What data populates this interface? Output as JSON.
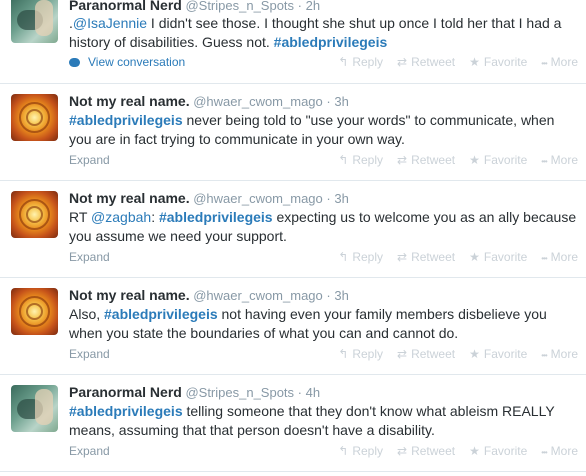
{
  "actions": {
    "reply": "Reply",
    "retweet": "Retweet",
    "favorite": "Favorite",
    "more": "More",
    "expand": "Expand",
    "view_conversation": "View conversation"
  },
  "tweets": [
    {
      "name": "Paranormal Nerd",
      "handle": "@Stripes_n_Spots",
      "time": "2h",
      "parts": [
        {
          "type": "text",
          "v": "."
        },
        {
          "type": "link",
          "v": "@IsaJennie"
        },
        {
          "type": "text",
          "v": " I didn't see those. I thought she shut up once I told her that I had a history of disabilities. Guess not. "
        },
        {
          "type": "hash",
          "v": "#abledprivilegeis"
        }
      ]
    },
    {
      "name": "Not my real name.",
      "handle": "@hwaer_cwom_mago",
      "time": "3h",
      "parts": [
        {
          "type": "hash",
          "v": "#abledprivilegeis"
        },
        {
          "type": "text",
          "v": " never being told to \"use your words\" to communicate, when you are in fact trying to communicate in your own way."
        }
      ]
    },
    {
      "name": "Not my real name.",
      "handle": "@hwaer_cwom_mago",
      "time": "3h",
      "parts": [
        {
          "type": "text",
          "v": "RT "
        },
        {
          "type": "link",
          "v": "@zagbah"
        },
        {
          "type": "text",
          "v": ": "
        },
        {
          "type": "hash",
          "v": "#abledprivilegeis"
        },
        {
          "type": "text",
          "v": " expecting us to welcome you as an ally because you assume we need your support."
        }
      ]
    },
    {
      "name": "Not my real name.",
      "handle": "@hwaer_cwom_mago",
      "time": "3h",
      "parts": [
        {
          "type": "text",
          "v": "Also, "
        },
        {
          "type": "hash",
          "v": "#abledprivilegeis"
        },
        {
          "type": "text",
          "v": " not having even your family members disbelieve you when you state the boundaries of what you can and cannot do."
        }
      ]
    },
    {
      "name": "Paranormal Nerd",
      "handle": "@Stripes_n_Spots",
      "time": "4h",
      "parts": [
        {
          "type": "hash",
          "v": "#abledprivilegeis"
        },
        {
          "type": "text",
          "v": " telling someone that they don't know what ableism REALLY means, assuming that that person doesn't have a disability."
        }
      ]
    }
  ]
}
